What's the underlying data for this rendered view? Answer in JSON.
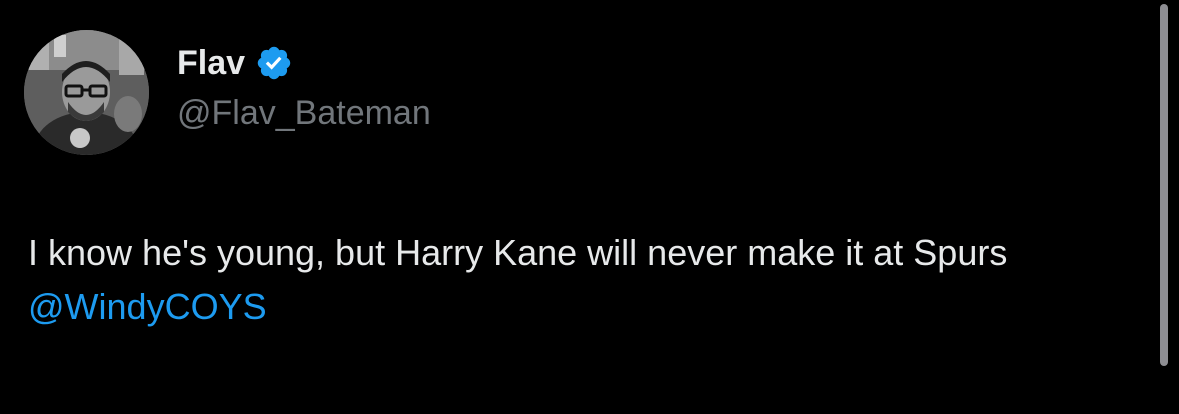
{
  "user": {
    "display_name": "Flav",
    "handle": "@Flav_Bateman",
    "verified_icon": "verified-badge-icon",
    "avatar": "profile-photo"
  },
  "tweet": {
    "text": "I know he's young, but Harry Kane will never make it at Spurs ",
    "mention": "@WindyCOYS"
  },
  "colors": {
    "background": "#000000",
    "text": "#e7e9ea",
    "secondary_text": "#71767b",
    "accent": "#1d9bf0"
  }
}
